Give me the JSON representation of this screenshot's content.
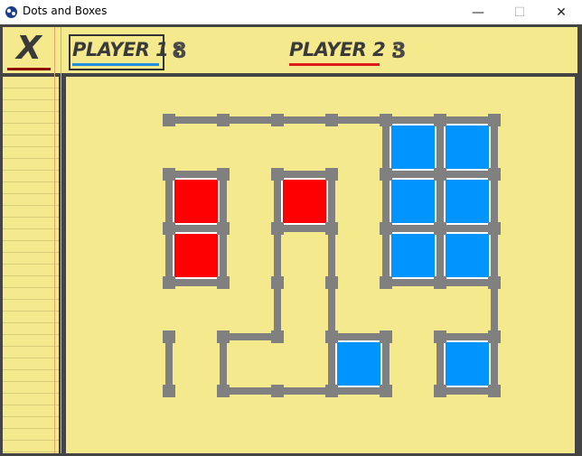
{
  "window": {
    "title": "Dots and Boxes"
  },
  "header": {
    "exit_label": "X",
    "player1_label": "PLAYER 1 :",
    "player1_score": "8",
    "player2_label": "PLAYER 2 :",
    "player2_score": "3"
  },
  "colors": {
    "background": "#f5e98e",
    "line": "#808080",
    "player1": "#0094ff",
    "player2": "#ff0000"
  },
  "grid": {
    "rows": 6,
    "cols": 7,
    "hlines": [
      [
        0,
        0
      ],
      [
        0,
        1
      ],
      [
        0,
        2
      ],
      [
        0,
        3
      ],
      [
        0,
        4
      ],
      [
        0,
        5
      ],
      [
        1,
        0
      ],
      [
        1,
        2
      ],
      [
        1,
        4
      ],
      [
        1,
        5
      ],
      [
        2,
        0
      ],
      [
        2,
        2
      ],
      [
        2,
        4
      ],
      [
        2,
        5
      ],
      [
        3,
        0
      ],
      [
        3,
        4
      ],
      [
        3,
        5
      ],
      [
        4,
        1
      ],
      [
        4,
        3
      ],
      [
        4,
        5
      ],
      [
        5,
        1
      ],
      [
        5,
        2
      ],
      [
        5,
        3
      ],
      [
        5,
        5
      ]
    ],
    "vlines": [
      [
        0,
        4
      ],
      [
        0,
        5
      ],
      [
        0,
        6
      ],
      [
        1,
        0
      ],
      [
        1,
        1
      ],
      [
        1,
        2
      ],
      [
        1,
        3
      ],
      [
        1,
        4
      ],
      [
        1,
        5
      ],
      [
        1,
        6
      ],
      [
        2,
        0
      ],
      [
        2,
        1
      ],
      [
        2,
        2
      ],
      [
        2,
        3
      ],
      [
        2,
        4
      ],
      [
        2,
        5
      ],
      [
        2,
        6
      ],
      [
        3,
        2
      ],
      [
        3,
        3
      ],
      [
        3,
        6
      ],
      [
        4,
        0
      ],
      [
        4,
        1
      ],
      [
        4,
        3
      ],
      [
        4,
        4
      ],
      [
        4,
        5
      ],
      [
        4,
        6
      ]
    ],
    "boxes": [
      {
        "row": 0,
        "col": 4,
        "owner": 1
      },
      {
        "row": 0,
        "col": 5,
        "owner": 1
      },
      {
        "row": 1,
        "col": 0,
        "owner": 2
      },
      {
        "row": 1,
        "col": 2,
        "owner": 2
      },
      {
        "row": 1,
        "col": 4,
        "owner": 1
      },
      {
        "row": 1,
        "col": 5,
        "owner": 1
      },
      {
        "row": 2,
        "col": 0,
        "owner": 2
      },
      {
        "row": 2,
        "col": 4,
        "owner": 1
      },
      {
        "row": 2,
        "col": 5,
        "owner": 1
      },
      {
        "row": 4,
        "col": 3,
        "owner": 1
      },
      {
        "row": 4,
        "col": 5,
        "owner": 1
      }
    ]
  }
}
